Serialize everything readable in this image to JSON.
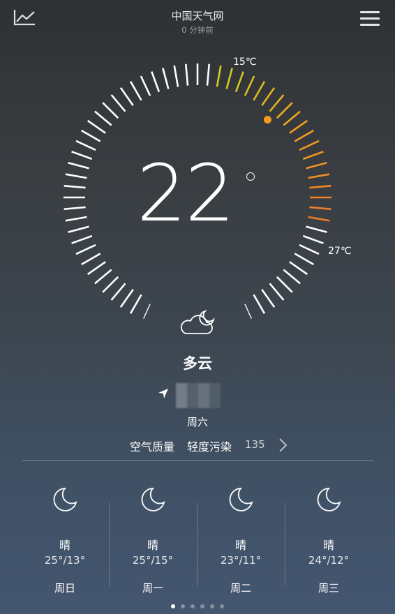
{
  "header": {
    "chart_icon": "line-chart-icon",
    "menu_icon": "hamburger-menu-icon",
    "title": "中国天气网",
    "updated": "0 分钟前"
  },
  "current": {
    "temperature": "22",
    "degree_symbol": "°",
    "min_temp_label": "15℃",
    "max_temp_label": "27℃",
    "min_temp": 15,
    "max_temp": 27,
    "current_temp": 22,
    "weather_icon": "partly-cloudy-night-icon",
    "condition": "多云",
    "location_icon": "location-arrow-icon",
    "weekday": "周六",
    "aqi": {
      "label": "空气质量",
      "level": "轻度污染",
      "value": "135",
      "chevron_icon": "chevron-right-icon"
    }
  },
  "forecast": [
    {
      "icon": "moon-icon",
      "condition": "晴",
      "range": "25°/13°",
      "day": "周日"
    },
    {
      "icon": "moon-icon",
      "condition": "晴",
      "range": "25°/15°",
      "day": "周一"
    },
    {
      "icon": "moon-icon",
      "condition": "晴",
      "range": "23°/11°",
      "day": "周二"
    },
    {
      "icon": "moon-icon",
      "condition": "晴",
      "range": "24°/12°",
      "day": "周三"
    }
  ],
  "pager": {
    "count": 6,
    "active": 0
  },
  "colors": {
    "tick_white": "#ffffff",
    "range_start": "#c8d41c",
    "range_mid": "#f2a21e",
    "range_end": "#f27a2c",
    "current_marker": "#f29a1e"
  }
}
